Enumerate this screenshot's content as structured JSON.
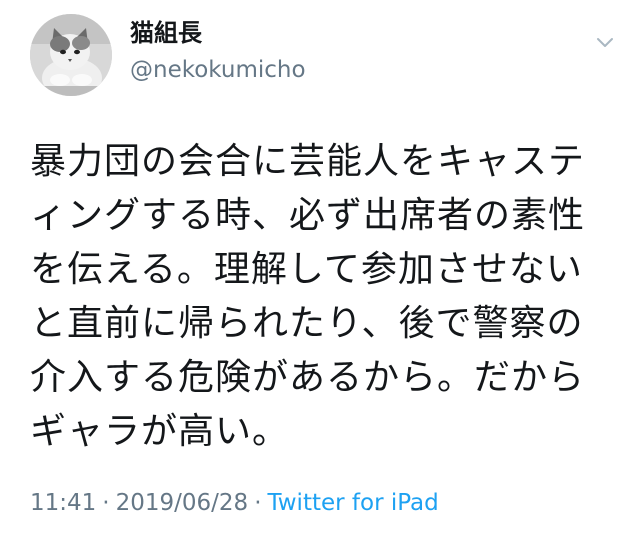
{
  "user": {
    "display_name": "猫組長",
    "handle": "@nekokumicho"
  },
  "tweet": {
    "lines": [
      "暴力団の会合に芸能人をキャステ",
      "ィングする時、必ず出席者の素性",
      "を伝える。理解して参加させない",
      "と直前に帰られたり、後で警察の",
      "介入する危険があるから。だから",
      "ギャラが高い。"
    ],
    "time": "11:41",
    "date": "2019/06/28",
    "separator": "·",
    "source": "Twitter for iPad"
  },
  "icons": {
    "menu": "chevron-down-icon",
    "avatar": "cat-avatar"
  },
  "colors": {
    "text": "#14171a",
    "secondary": "#657786",
    "link": "#1da1f2"
  }
}
